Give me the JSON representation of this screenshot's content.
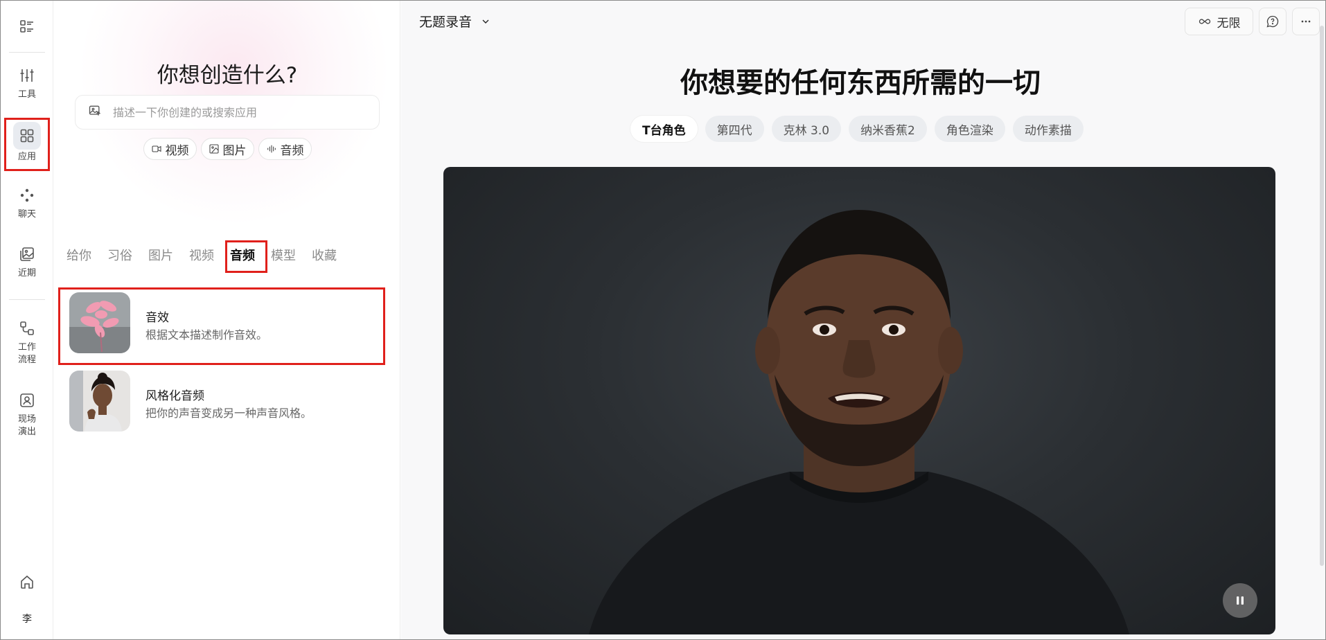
{
  "rail": {
    "items": [
      {
        "label": "工具"
      },
      {
        "label": "应用"
      },
      {
        "label": "聊天"
      },
      {
        "label": "近期"
      },
      {
        "label": "工作\n流程"
      },
      {
        "label": "现场\n演出"
      }
    ],
    "user_initial": "李"
  },
  "panel": {
    "title": "你想创造什么?",
    "search_placeholder": "描述一下你创建的或搜索应用",
    "chips": [
      "视频",
      "图片",
      "音频"
    ],
    "tabs": [
      "给你",
      "习俗",
      "图片",
      "视频",
      "音频",
      "模型",
      "收藏"
    ],
    "active_tab": "音频",
    "apps": [
      {
        "name": "音效",
        "desc": "根据文本描述制作音效。"
      },
      {
        "name": "风格化音频",
        "desc": "把你的声音变成另一种声音风格。"
      }
    ]
  },
  "main": {
    "doc_title": "无题录音",
    "unlimited_label": "无限",
    "hero_title": "你想要的任何东西所需的一切",
    "pills": [
      "T台角色",
      "第四代",
      "克林 3.0",
      "纳米香蕉2",
      "角色渲染",
      "动作素描"
    ],
    "active_pill": "T台角色"
  },
  "colors": {
    "highlight": "#e0201b",
    "active_bg": "#e8ebf0"
  }
}
